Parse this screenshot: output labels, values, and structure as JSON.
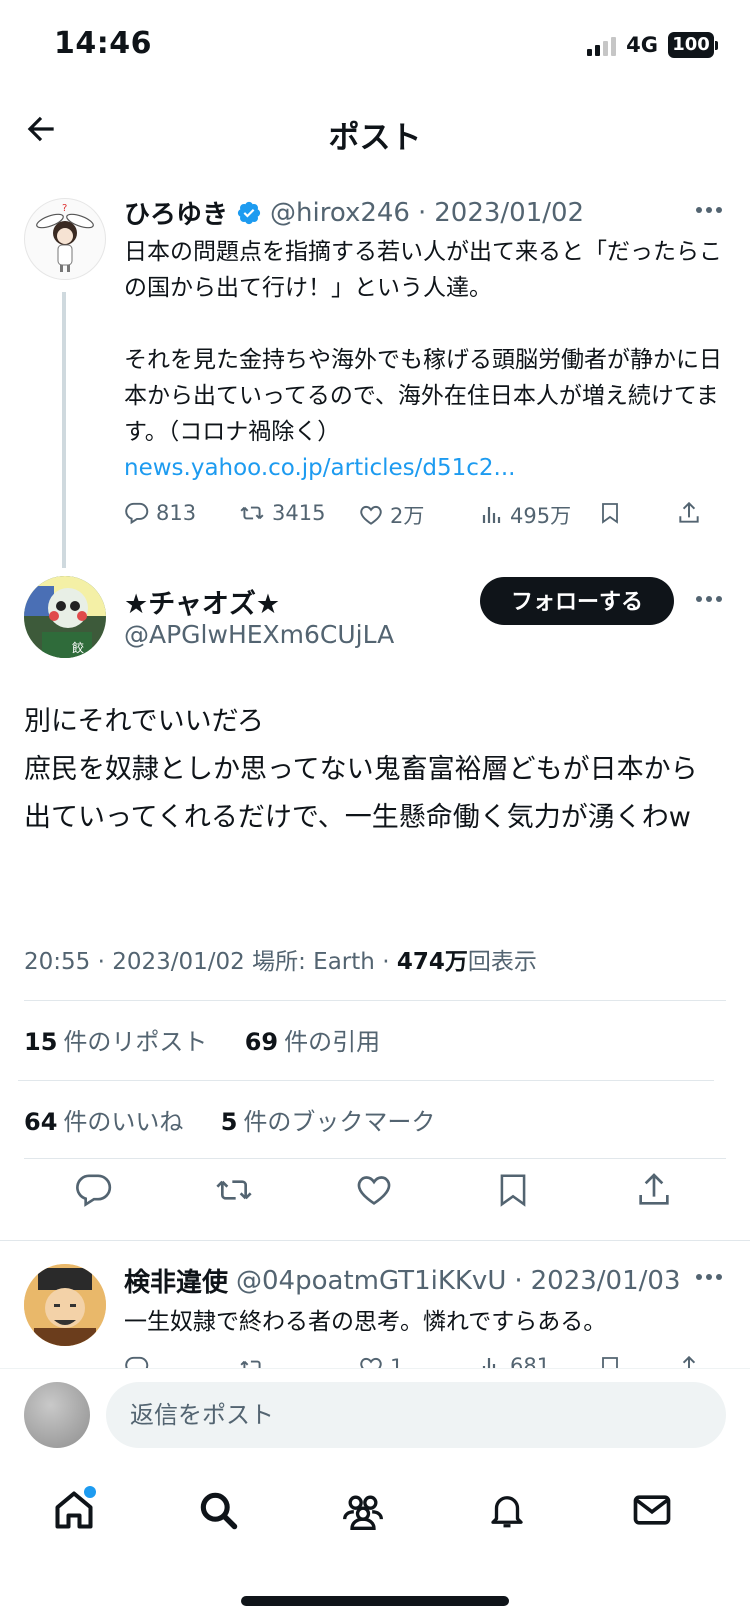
{
  "status_bar": {
    "time": "14:46",
    "network": "4G",
    "battery": "100"
  },
  "header": {
    "title": "ポスト"
  },
  "parent_tweet": {
    "name": "ひろゆき",
    "handle": "@hirox246",
    "date": "2023/01/02",
    "text_lines": [
      "日本の問題点を指摘する若い人が出て来ると「だったらこの国から出て行け！」という人達。",
      "それを見た金持ちや海外でも稼げる頭脳労働者が静かに日本から出ていってるので、海外在住日本人が増え続けてます。（コロナ禍除く）"
    ],
    "link": "news.yahoo.co.jp/articles/d51c2...",
    "replies": "813",
    "reposts": "3415",
    "likes": "2万",
    "views": "495万"
  },
  "focal_tweet": {
    "name": "★チャオズ★",
    "handle": "@APGlwHEXm6CUjLA",
    "follow_label": "フォローする",
    "text_lines": [
      "別にそれでいいだろ",
      "庶民を奴隷としか思ってない鬼畜富裕層どもが日本から出ていってくれるだけで、一生懸命働く気力が湧くわw"
    ],
    "meta": {
      "time": "20:55",
      "date": "2023/01/02",
      "location": "場所: Earth",
      "views_count": "474万",
      "views_label": "回表示"
    },
    "stats": {
      "reposts_count": "15",
      "reposts_label": "件のリポスト",
      "quotes_count": "69",
      "quotes_label": "件の引用",
      "likes_count": "64",
      "likes_label": "件のいいね",
      "bookmarks_count": "5",
      "bookmarks_label": "件のブックマーク"
    }
  },
  "reply_tweet": {
    "name": "検非違使",
    "handle": "@04poatmGT1iKKvU",
    "date": "2023/01/03",
    "text": "一生奴隷で終わる者の思考。憐れですらある。",
    "likes": "1",
    "views": "681"
  },
  "compose": {
    "placeholder": "返信をポスト"
  },
  "colors": {
    "accent": "#1d9bf0",
    "text": "#0f1419",
    "muted": "#536471"
  }
}
